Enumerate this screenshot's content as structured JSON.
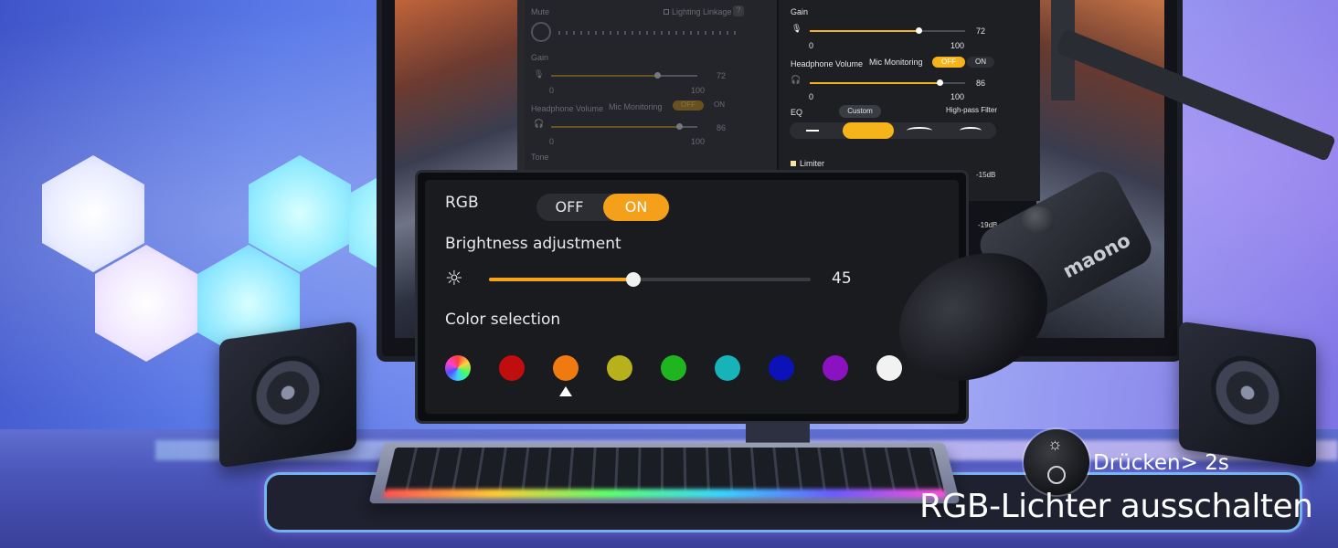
{
  "software_dim": {
    "mute_label": "Mute",
    "lighting_linkage_label": "Lighting Linkage",
    "lighting_linkage_help": "?",
    "gain_label": "Gain",
    "gain_min": "0",
    "gain_max": "100",
    "gain_value": "72",
    "headphone_volume_label": "Headphone Volume",
    "mic_monitoring_label": "Mic Monitoring",
    "monitoring_off": "OFF",
    "monitoring_on": "ON",
    "headphone_value": "86",
    "headphone_min": "0",
    "headphone_max": "100",
    "tone_label": "Tone"
  },
  "software_bright": {
    "gain_label": "Gain",
    "gain_min": "0",
    "gain_max": "100",
    "gain_value": "72",
    "headphone_volume_label": "Headphone Volume",
    "mic_monitoring_label": "Mic Monitoring",
    "monitoring_off": "OFF",
    "monitoring_on": "ON",
    "headphone_value": "86",
    "headphone_min": "0",
    "headphone_max": "100",
    "eq_label": "EQ",
    "eq_preset": "Custom",
    "high_pass_label": "High-pass Filter",
    "limiter_label": "Limiter",
    "db_a": "-15dB",
    "db_b": "-19dB"
  },
  "rgb_panel": {
    "title": "RGB",
    "toggle_off": "OFF",
    "toggle_on": "ON",
    "toggle_state": "ON",
    "brightness_label": "Brightness adjustment",
    "brightness_value": "45",
    "color_label": "Color selection",
    "colors": [
      "rainbow",
      "#c00d0d",
      "#f07a10",
      "#b7b21c",
      "#1fb51f",
      "#16b3b9",
      "#0c12b8",
      "#8a12c0",
      "#f2f2f2"
    ],
    "selected_color_index": 2
  },
  "mic": {
    "brand": "maono"
  },
  "callout": {
    "press_text": "Drücken> 2s",
    "title": "RGB-Lichter ausschalten"
  }
}
